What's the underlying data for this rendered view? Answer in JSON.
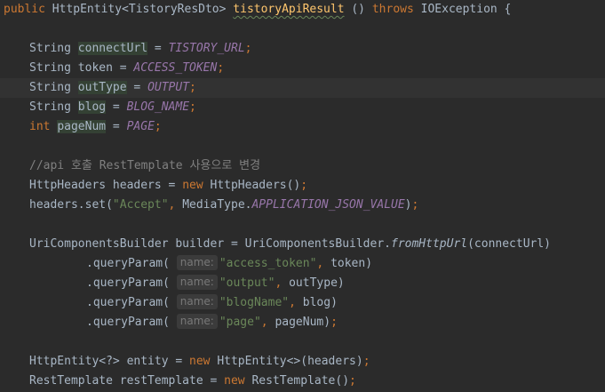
{
  "editor": {
    "lines": [
      {
        "id": "sig",
        "indent": 0,
        "tokens": [
          {
            "t": "kw",
            "v": "public"
          },
          {
            "t": "ident",
            "v": " HttpEntity<TistoryResDto> "
          },
          {
            "t": "fn-squiggle",
            "v": "tistoryApiResult"
          },
          {
            "t": "ident",
            "v": " () "
          },
          {
            "t": "kw",
            "v": "throws"
          },
          {
            "t": "ident",
            "v": " IOException {"
          }
        ]
      },
      {
        "id": "blank1",
        "indent": 0,
        "tokens": []
      },
      {
        "id": "decl-connectUrl",
        "indent": 1,
        "tokens": [
          {
            "t": "ident",
            "v": "String "
          },
          {
            "t": "hlvar",
            "v": "connectUrl"
          },
          {
            "t": "ident",
            "v": " = "
          },
          {
            "t": "const",
            "v": "TISTORY_URL"
          },
          {
            "t": "kw",
            "v": ";"
          }
        ]
      },
      {
        "id": "decl-token",
        "indent": 1,
        "tokens": [
          {
            "t": "ident",
            "v": "String token = "
          },
          {
            "t": "const",
            "v": "ACCESS_TOKEN"
          },
          {
            "t": "kw",
            "v": ";"
          }
        ]
      },
      {
        "id": "decl-outType",
        "indent": 1,
        "current": true,
        "tokens": [
          {
            "t": "ident",
            "v": "String "
          },
          {
            "t": "hlvar",
            "v": "outType"
          },
          {
            "t": "ident",
            "v": " = "
          },
          {
            "t": "const",
            "v": "OUTPUT"
          },
          {
            "t": "kw",
            "v": ";"
          }
        ]
      },
      {
        "id": "decl-blog",
        "indent": 1,
        "tokens": [
          {
            "t": "ident",
            "v": "String "
          },
          {
            "t": "hlvar",
            "v": "blog"
          },
          {
            "t": "ident",
            "v": " = "
          },
          {
            "t": "const",
            "v": "BLOG_NAME"
          },
          {
            "t": "kw",
            "v": ";"
          }
        ]
      },
      {
        "id": "decl-pageNum",
        "indent": 1,
        "tokens": [
          {
            "t": "kw",
            "v": "int "
          },
          {
            "t": "hlvar",
            "v": "pageNum"
          },
          {
            "t": "ident",
            "v": " = "
          },
          {
            "t": "const",
            "v": "PAGE"
          },
          {
            "t": "kw",
            "v": ";"
          }
        ]
      },
      {
        "id": "blank2",
        "indent": 0,
        "tokens": []
      },
      {
        "id": "comment",
        "indent": 1,
        "tokens": [
          {
            "t": "comment",
            "v": "//api 호출 RestTemplate 사용으로 변경"
          }
        ]
      },
      {
        "id": "headers-new",
        "indent": 1,
        "tokens": [
          {
            "t": "ident",
            "v": "HttpHeaders headers = "
          },
          {
            "t": "kw",
            "v": "new "
          },
          {
            "t": "ident",
            "v": "HttpHeaders()"
          },
          {
            "t": "kw",
            "v": ";"
          }
        ]
      },
      {
        "id": "headers-set",
        "indent": 1,
        "tokens": [
          {
            "t": "ident",
            "v": "headers.set("
          },
          {
            "t": "str",
            "v": "\"Accept\""
          },
          {
            "t": "kw",
            "v": ", "
          },
          {
            "t": "ident",
            "v": "MediaType."
          },
          {
            "t": "const",
            "v": "APPLICATION_JSON_VALUE"
          },
          {
            "t": "ident",
            "v": ")"
          },
          {
            "t": "kw",
            "v": ";"
          }
        ]
      },
      {
        "id": "blank3",
        "indent": 0,
        "tokens": []
      },
      {
        "id": "builder",
        "indent": 1,
        "tokens": [
          {
            "t": "ident",
            "v": "UriComponentsBuilder builder = UriComponentsBuilder."
          },
          {
            "t": "static",
            "v": "fromHttpUrl"
          },
          {
            "t": "ident",
            "v": "(connectUrl)"
          }
        ]
      },
      {
        "id": "qp-access-token",
        "indent": 2,
        "tokens": [
          {
            "t": "ident",
            "v": ".queryParam( "
          },
          {
            "t": "hint",
            "v": "name:"
          },
          {
            "t": "str",
            "v": "\"access_token\""
          },
          {
            "t": "kw",
            "v": ", "
          },
          {
            "t": "ident",
            "v": "token)"
          }
        ]
      },
      {
        "id": "qp-output",
        "indent": 2,
        "tokens": [
          {
            "t": "ident",
            "v": ".queryParam( "
          },
          {
            "t": "hint",
            "v": "name:"
          },
          {
            "t": "str",
            "v": "\"output\""
          },
          {
            "t": "kw",
            "v": ", "
          },
          {
            "t": "ident",
            "v": "outType)"
          }
        ]
      },
      {
        "id": "qp-blogname",
        "indent": 2,
        "tokens": [
          {
            "t": "ident",
            "v": ".queryParam( "
          },
          {
            "t": "hint",
            "v": "name:"
          },
          {
            "t": "str",
            "v": "\"blogName\""
          },
          {
            "t": "kw",
            "v": ", "
          },
          {
            "t": "ident",
            "v": "blog)"
          }
        ]
      },
      {
        "id": "qp-page",
        "indent": 2,
        "tokens": [
          {
            "t": "ident",
            "v": ".queryParam( "
          },
          {
            "t": "hint",
            "v": "name:"
          },
          {
            "t": "str",
            "v": "\"page\""
          },
          {
            "t": "kw",
            "v": ", "
          },
          {
            "t": "ident",
            "v": "pageNum)"
          },
          {
            "t": "kw",
            "v": ";"
          }
        ]
      },
      {
        "id": "blank4",
        "indent": 0,
        "tokens": []
      },
      {
        "id": "entity",
        "indent": 1,
        "tokens": [
          {
            "t": "ident",
            "v": "HttpEntity<?> entity = "
          },
          {
            "t": "kw",
            "v": "new "
          },
          {
            "t": "ident",
            "v": "HttpEntity<>(headers)"
          },
          {
            "t": "kw",
            "v": ";"
          }
        ]
      },
      {
        "id": "rest-template",
        "indent": 1,
        "tokens": [
          {
            "t": "ident",
            "v": "RestTemplate restTemplate = "
          },
          {
            "t": "kw",
            "v": "new "
          },
          {
            "t": "ident",
            "v": "RestTemplate()"
          },
          {
            "t": "kw",
            "v": ";"
          }
        ]
      }
    ]
  },
  "colors": {
    "background": "#2b2b2b",
    "current_line": "#323232",
    "keyword": "#cc7832",
    "method_decl": "#ffc66d",
    "string": "#6a8759",
    "constant": "#9876aa",
    "comment": "#808080",
    "default_text": "#a9b7c6",
    "usage_highlight": "#344134",
    "inlay_hint_bg": "#3b3b3b",
    "inlay_hint_fg": "#787878"
  }
}
